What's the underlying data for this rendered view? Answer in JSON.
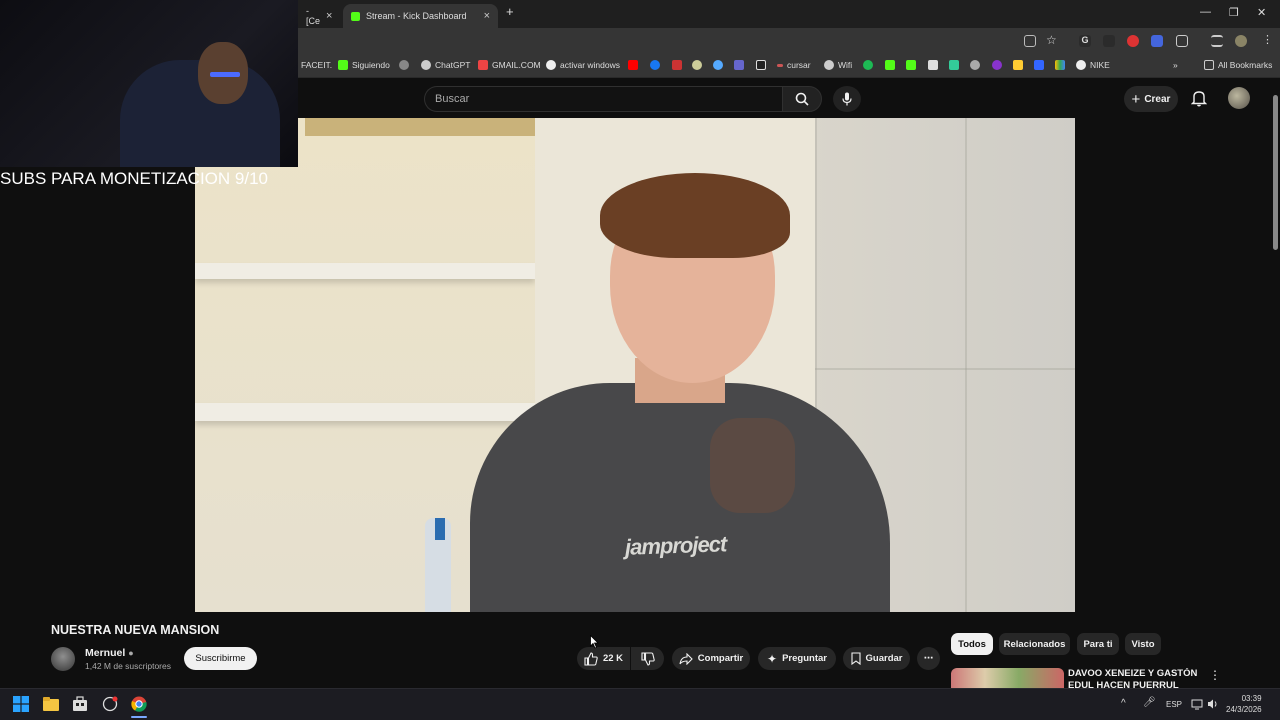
{
  "browser": {
    "tabs": [
      {
        "label": "- [Ce",
        "active": false
      },
      {
        "label": "Stream - Kick Dashboard",
        "active": true
      }
    ],
    "new_tab": "+",
    "bookmarks": [
      "FACEIT.",
      "Siguiendo",
      "ChatGPT",
      "GMAIL.COM",
      "activar windows",
      "cursar",
      "Wifi",
      "NIKE"
    ],
    "all_bookmarks": "All Bookmarks",
    "more": "»"
  },
  "youtube": {
    "search_placeholder": "Buscar",
    "create_label": "Crear",
    "video": {
      "title": "NUESTRA NUEVA MANSION",
      "shirt_text": "jamproject"
    },
    "channel": {
      "name": "Mernuel",
      "subscribers": "1,42 M de suscriptores",
      "subscribe_label": "Suscribirme"
    },
    "actions": {
      "likes": "22 K",
      "share": "Compartir",
      "ask": "Preguntar",
      "save": "Guardar"
    },
    "chips": [
      "Todos",
      "Relacionados",
      "Para ti",
      "Visto"
    ],
    "recommendation": {
      "title": "DAVOO XENEIZE Y GASTÓN EDUL HACEN PUERRUL"
    }
  },
  "overlay": {
    "text": "SUBS PARA MONETIZACION 9/10"
  },
  "taskbar": {
    "language": "ESP",
    "time": "03:39",
    "date": "24/3/2026"
  },
  "colors": {
    "youtube_bg": "#0f0f0f",
    "pill_bg": "#272727",
    "chrome_bg": "#353535"
  }
}
